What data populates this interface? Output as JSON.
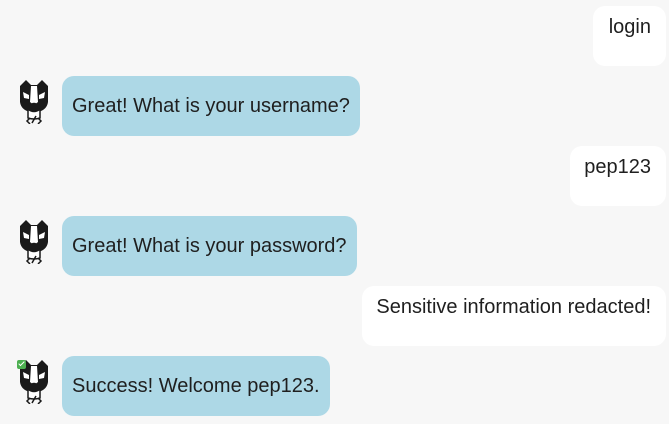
{
  "messages": [
    {
      "role": "user",
      "text": "login"
    },
    {
      "role": "bot",
      "text": "Great! What is your username?",
      "avatar": "badger-bot-icon",
      "badge": false
    },
    {
      "role": "user",
      "text": "pep123"
    },
    {
      "role": "bot",
      "text": "Great! What is your password?",
      "avatar": "badger-bot-icon",
      "badge": false
    },
    {
      "role": "user",
      "text": "Sensitive information redacted!"
    },
    {
      "role": "bot",
      "text": "Success! Welcome pep123.",
      "avatar": "badger-bot-icon",
      "badge": true
    }
  ],
  "colors": {
    "background": "#f7f7f7",
    "user_bubble": "#ffffff",
    "bot_bubble": "#add8e6",
    "check_badge": "#4caf50"
  }
}
